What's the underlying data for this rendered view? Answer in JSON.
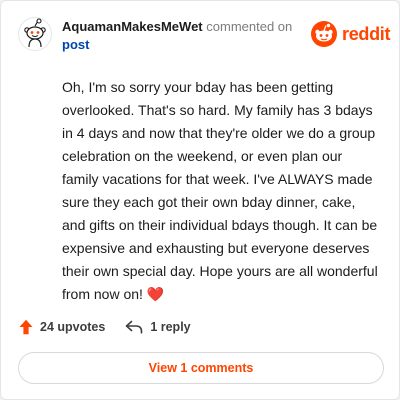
{
  "comment": {
    "author": "AquamanMakesMeWet",
    "action": "commented on",
    "target": "post",
    "text": "Oh, I'm so sorry your bday has been getting overlooked. That's so hard. My family has 3 bdays in 4 days and now that they're older we do a group celebration on the weekend, or even plan our family vacations for that week. I've ALWAYS made sure they each got their own bday dinner, cake, and gifts on their individual bdays though. It can be expensive and exhausting but everyone deserves their own special day. Hope yours are all wonderful from now on!",
    "emoji": "❤️"
  },
  "brand": {
    "wordmark": "reddit",
    "color": "#ff4500"
  },
  "actions": {
    "upvotes_label": "24 upvotes",
    "reply_label": "1 reply",
    "upvote_icon": "upvote-arrow-icon",
    "reply_icon": "reply-arrow-icon"
  },
  "footer": {
    "view_comments_label": "View 1 comments"
  },
  "colors": {
    "accent": "#ff4500",
    "link": "#0045ac",
    "text": "#1c1c1c",
    "muted": "#7c7c7c"
  }
}
